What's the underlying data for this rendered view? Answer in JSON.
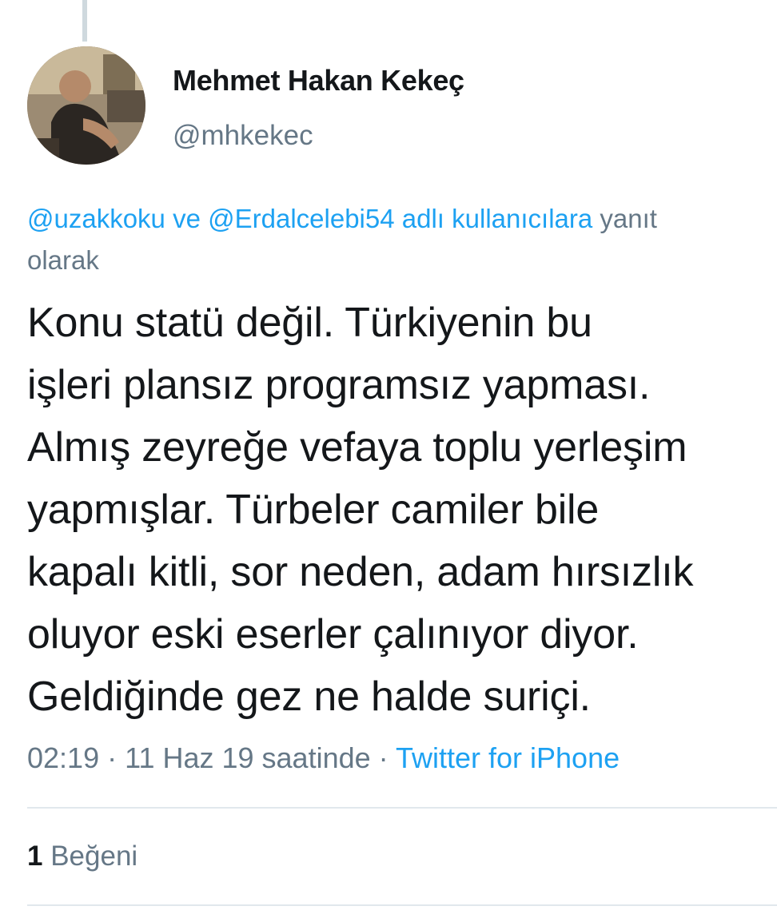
{
  "author": {
    "name": "Mehmet Hakan Kekeç",
    "handle": "@mhkekec"
  },
  "reply_context": {
    "mention1": "@uzakkoku",
    "connector": " ve ",
    "mention2": "@Erdalcelebi54",
    "suffix_link": " adlı kullanıcılara",
    "suffix_text": " yanıt",
    "line2": "olarak"
  },
  "tweet": {
    "lines": [
      "Konu statü değil. Türkiyenin bu",
      "işleri plansız programsız yapması.",
      "Almış zeyreğe vefaya toplu yerleşim",
      "yapmışlar. Türbeler camiler bile",
      "kapalı kitli, sor neden, adam hırsızlık",
      "oluyor eski eserler çalınıyor diyor.",
      "Geldiğinde gez ne halde suriçi."
    ]
  },
  "meta": {
    "time": "02:19",
    "separator1": " · ",
    "date": "11 Haz 19 saatinde",
    "separator2": " · ",
    "source": "Twitter for iPhone"
  },
  "likes": {
    "count": "1",
    "label": "Beğeni"
  },
  "colors": {
    "link": "#1da1f2",
    "secondary_text": "#657786",
    "primary_text": "#14171a",
    "divider": "#e1e8ed"
  }
}
